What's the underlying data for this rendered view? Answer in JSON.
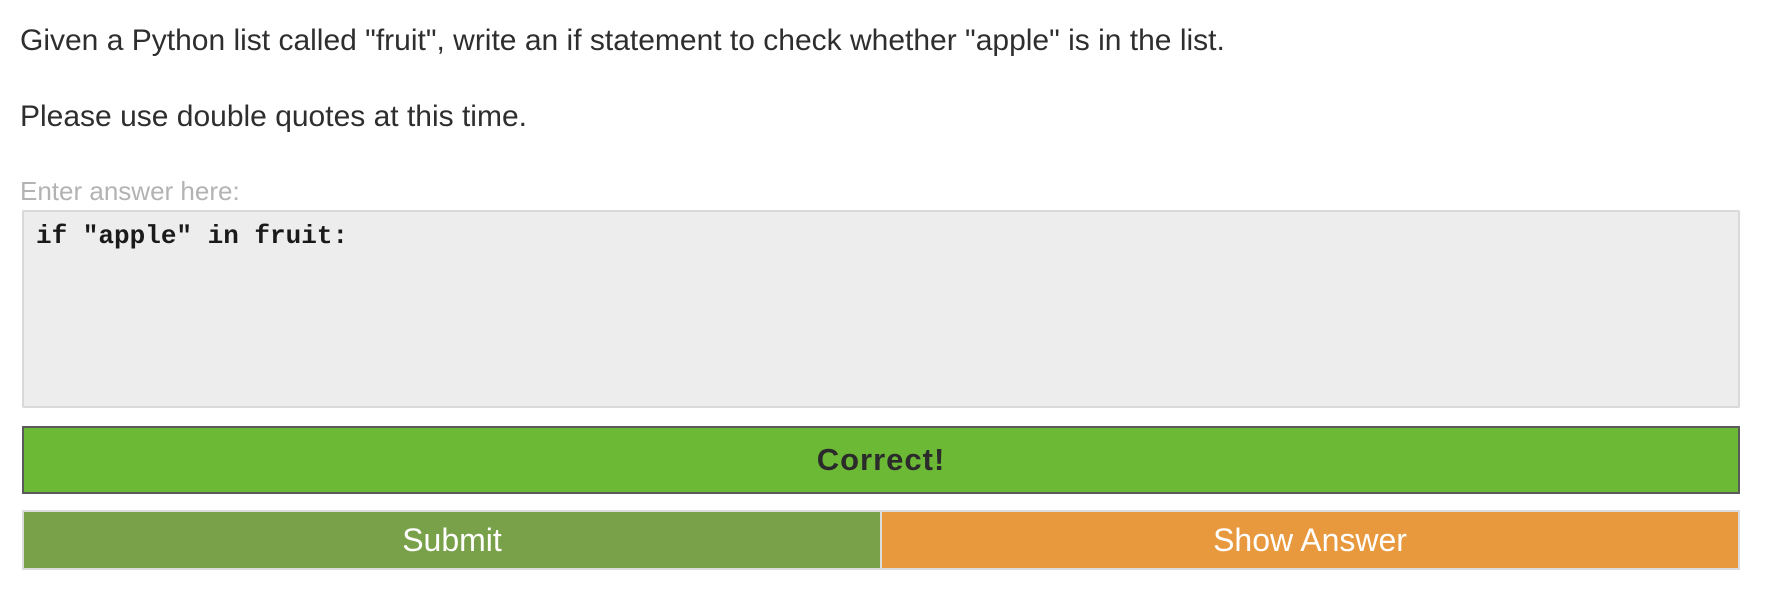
{
  "question": {
    "line1": "Given a Python list called \"fruit\", write an if statement to check whether \"apple\" is in the list.",
    "line2": "Please use double quotes at this time."
  },
  "answer": {
    "label": "Enter answer here:",
    "value": "if \"apple\" in fruit:"
  },
  "result": {
    "text": "Correct!",
    "color": "#6cb935"
  },
  "buttons": {
    "submit_label": "Submit",
    "submit_color": "#79a14a",
    "show_answer_label": "Show Answer",
    "show_answer_color": "#e8983d"
  }
}
